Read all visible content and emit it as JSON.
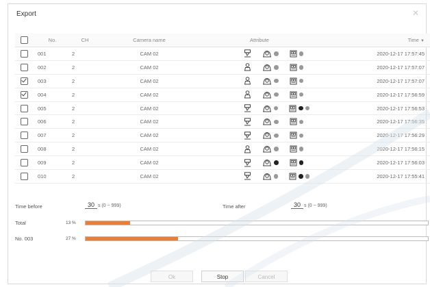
{
  "dialog": {
    "title": "Export",
    "close_icon": "close-icon"
  },
  "table": {
    "headers": {
      "no": "No.",
      "ch": "CH",
      "camera": "Camera name",
      "attribute": "Attribute",
      "time": "Time"
    },
    "sort_icon": "sort-desc-icon",
    "rows": [
      {
        "checked": false,
        "no": "001",
        "ch": "2",
        "camera": "CAM 02",
        "person": "fixed-person-icon",
        "face_dots": [
          "gray"
        ],
        "vehicle_dots": [
          "gray"
        ],
        "time": "2020-12-17 17:57:45"
      },
      {
        "checked": false,
        "no": "002",
        "ch": "2",
        "camera": "CAM 02",
        "person": "person-icon",
        "face_dots": [
          "gray"
        ],
        "vehicle_dots": [
          "gray"
        ],
        "time": "2020-12-17 17:57:07"
      },
      {
        "checked": true,
        "no": "003",
        "ch": "2",
        "camera": "CAM 02",
        "person": "person-icon",
        "face_dots": [
          "gray"
        ],
        "vehicle_dots": [
          "gray"
        ],
        "time": "2020-12-17 17:57:07"
      },
      {
        "checked": true,
        "no": "004",
        "ch": "2",
        "camera": "CAM 02",
        "person": "person-icon",
        "face_dots": [
          "gray"
        ],
        "vehicle_dots": [
          "gray"
        ],
        "time": "2020-12-17 17:56:59"
      },
      {
        "checked": false,
        "no": "005",
        "ch": "2",
        "camera": "CAM 02",
        "person": "fixed-person-icon",
        "face_dots": [
          "gray"
        ],
        "vehicle_dots": [
          "black",
          "gray"
        ],
        "time": "2020-12-17 17:56:53"
      },
      {
        "checked": false,
        "no": "006",
        "ch": "2",
        "camera": "CAM 02",
        "person": "fixed-person-icon",
        "face_dots": [
          "gray"
        ],
        "vehicle_dots": [
          "gray"
        ],
        "time": "2020-12-17 17:56:35"
      },
      {
        "checked": false,
        "no": "007",
        "ch": "2",
        "camera": "CAM 02",
        "person": "fixed-person-icon",
        "face_dots": [
          "gray"
        ],
        "vehicle_dots": [
          "gray"
        ],
        "time": "2020-12-17 17:56:29"
      },
      {
        "checked": false,
        "no": "008",
        "ch": "2",
        "camera": "CAM 02",
        "person": "person-icon",
        "face_dots": [
          "gray"
        ],
        "vehicle_dots": [
          "gray"
        ],
        "time": "2020-12-17 17:56:15"
      },
      {
        "checked": false,
        "no": "009",
        "ch": "2",
        "camera": "CAM 02",
        "person": "fixed-person-icon",
        "face_dots": [
          "black"
        ],
        "vehicle_dots": [
          "black"
        ],
        "time": "2020-12-17 17:56:03"
      },
      {
        "checked": false,
        "no": "010",
        "ch": "2",
        "camera": "CAM 02",
        "person": "fixed-person-icon",
        "face_dots": [
          "gray"
        ],
        "vehicle_dots": [
          "black",
          "gray"
        ],
        "time": "2020-12-17 17:55:41"
      }
    ]
  },
  "settings": {
    "time_before_label": "Time before",
    "time_before_value": "30",
    "time_before_hint": "s (0 ~ 999)",
    "time_after_label": "Time after",
    "time_after_value": "30",
    "time_after_hint": "s (0 ~ 999)"
  },
  "progress": {
    "total_label": "Total",
    "total_pct_text": "13 %",
    "total_fraction": 0.13,
    "item_label": "No. 003",
    "item_pct_text": "27 %",
    "item_fraction": 0.27
  },
  "buttons": {
    "ok": "Ok",
    "stop": "Stop",
    "cancel": "Cancel"
  },
  "colors": {
    "progress_fill": "#f07c30",
    "dot_gray": "#999999",
    "dot_black": "#222222"
  }
}
